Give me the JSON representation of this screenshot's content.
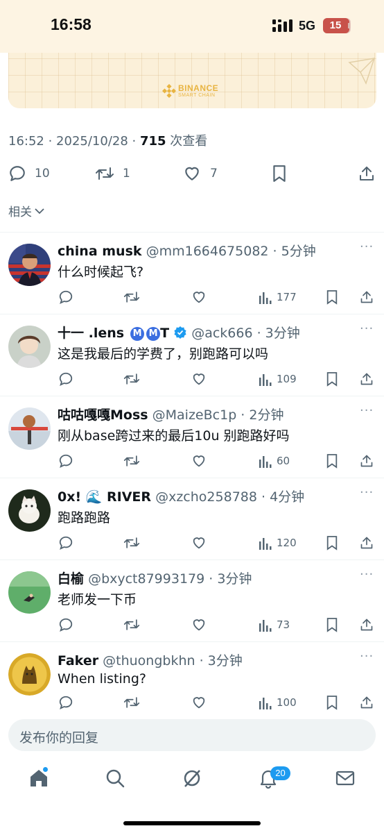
{
  "status": {
    "time": "16:58",
    "network": "5G",
    "battery": "15"
  },
  "card": {
    "brand": "BINANCE",
    "sub": "SMART CHAIN"
  },
  "post": {
    "meta_prefix": "16:52 · 2025/10/28 · ",
    "views": "715",
    "views_suffix": " 次查看"
  },
  "actions": {
    "replies": "10",
    "reposts": "1",
    "likes": "7"
  },
  "related_label": "相关",
  "replies": [
    {
      "name": "china musk",
      "handle": "@mm1664675082",
      "time": "· 5分钟",
      "text": "什么时候起飞?",
      "views": "177"
    },
    {
      "name": "十一 .lens",
      "badge_letters": [
        "M",
        "M"
      ],
      "name_suffix": "T",
      "handle": "@ack666",
      "time": "· 3分钟",
      "text": "这是我最后的学费了，别跑路可以吗",
      "views": "109"
    },
    {
      "name": "咕咕嘎嘎Moss",
      "handle": "@MaizeBc1p",
      "time": "· 2分钟",
      "text": "刚从base跨过来的最后10u 别跑路好吗",
      "views": "60"
    },
    {
      "name": "0x! 🌊 RIVER",
      "handle": "@xzcho258788",
      "time": "· 4分钟",
      "text": "跑路跑路",
      "views": "120"
    },
    {
      "name": "白榆",
      "handle": "@bxyct87993179",
      "time": "· 3分钟",
      "text": "老师发一下币",
      "views": "73"
    },
    {
      "name": "Faker",
      "handle": "@thuongbkhn",
      "time": "· 3分钟",
      "text": "When listing?",
      "views": "100"
    }
  ],
  "compose": {
    "placeholder": "发布你的回复"
  },
  "tabbar": {
    "notifications_count": "20"
  },
  "colors": {
    "accent": "#1d9bf0",
    "text_secondary": "#536471",
    "card_bg": "#fbf0d9",
    "binance_gold": "#e8b441"
  }
}
